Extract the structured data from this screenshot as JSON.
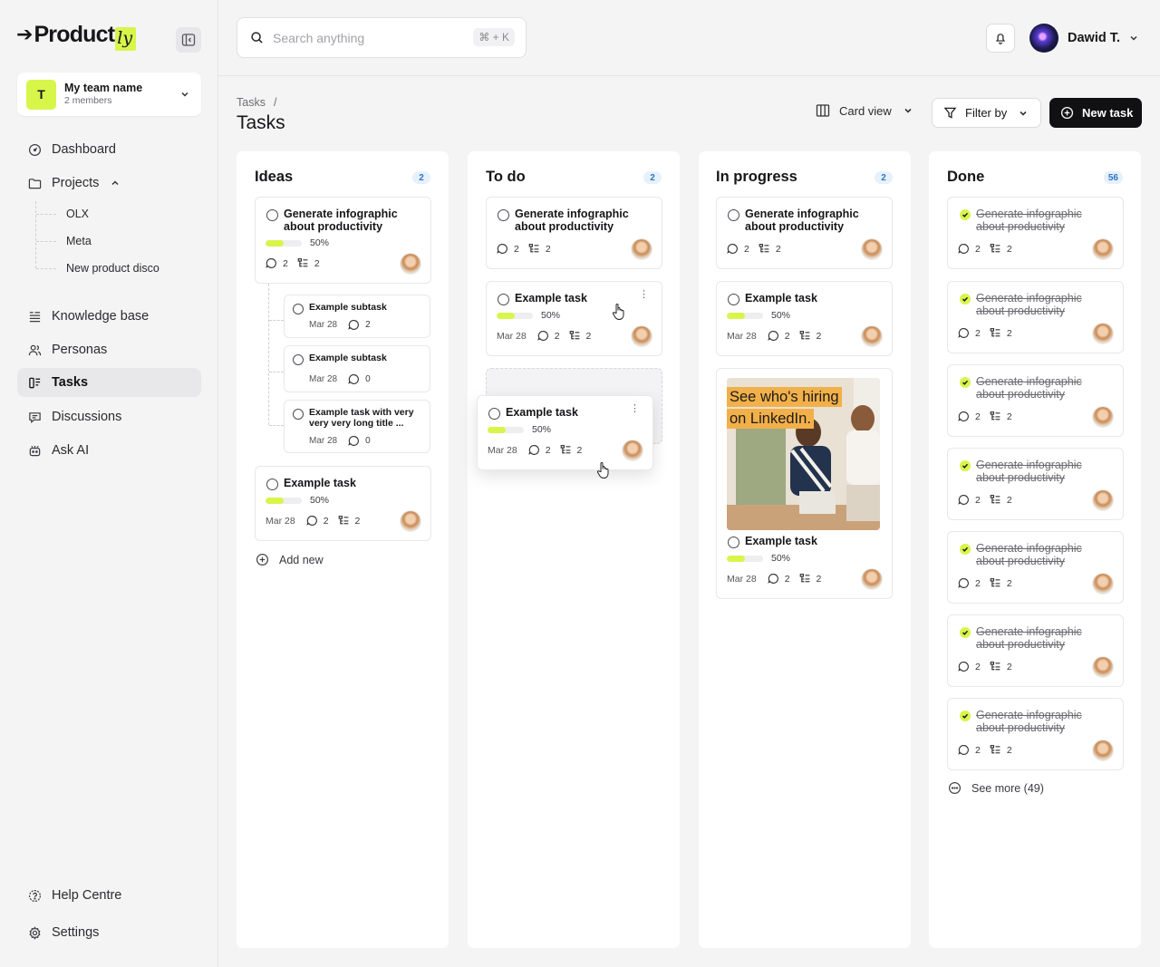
{
  "brand": {
    "name": "Product",
    "suffix": "ly"
  },
  "team": {
    "initial": "T",
    "name": "My team name",
    "members": "2 members"
  },
  "nav": {
    "dashboard": "Dashboard",
    "projects": "Projects",
    "projects_children": [
      "OLX",
      "Meta",
      "New product disco"
    ],
    "knowledge_base": "Knowledge base",
    "personas": "Personas",
    "tasks": "Tasks",
    "discussions": "Discussions",
    "ask_ai": "Ask AI",
    "help_centre": "Help Centre",
    "settings": "Settings"
  },
  "search": {
    "placeholder": "Search anything",
    "shortcut": "⌘ + K"
  },
  "user": {
    "name": "Dawid T."
  },
  "page": {
    "breadcrumb_root": "Tasks",
    "breadcrumb_sep": "/",
    "title": "Tasks",
    "view_label": "Card view",
    "filter_label": "Filter by",
    "new_task_label": "New task"
  },
  "columns": [
    {
      "title": "Ideas",
      "count": "2"
    },
    {
      "title": "To do",
      "count": "2"
    },
    {
      "title": "In progress",
      "count": "2"
    },
    {
      "title": "Done",
      "count": "56"
    }
  ],
  "ideas": {
    "card1": {
      "title": "Generate infographic about productivity",
      "progress": "50%",
      "progress_value": 0.5,
      "comments": "2",
      "subtasks": "2"
    },
    "subtasks": [
      {
        "title": "Example subtask",
        "date": "Mar 28",
        "comments": "2"
      },
      {
        "title": "Example subtask",
        "date": "Mar 28",
        "comments": "0"
      },
      {
        "title": "Example task with very very very long title ...",
        "date": "Mar 28",
        "comments": "0"
      }
    ],
    "card2": {
      "title": "Example task",
      "progress": "50%",
      "progress_value": 0.5,
      "date": "Mar 28",
      "comments": "2",
      "subtasks": "2"
    },
    "add_new": "Add new"
  },
  "todo": {
    "card1": {
      "title": "Generate infographic about productivity",
      "comments": "2",
      "subtasks": "2"
    },
    "card2": {
      "title": "Example task",
      "progress": "50%",
      "progress_value": 0.5,
      "date": "Mar 28",
      "comments": "2",
      "subtasks": "2"
    },
    "dragging": {
      "title": "Example task",
      "progress": "50%",
      "progress_value": 0.5,
      "date": "Mar 28",
      "comments": "2",
      "subtasks": "2"
    }
  },
  "inprogress": {
    "card1": {
      "title": "Generate infographic about productivity",
      "comments": "2",
      "subtasks": "2"
    },
    "card2": {
      "title": "Example task",
      "progress": "50%",
      "progress_value": 0.5,
      "date": "Mar 28",
      "comments": "2",
      "subtasks": "2"
    },
    "card3": {
      "image_text_line1": "See who's hiring",
      "image_text_line2": "on LinkedIn.",
      "title": "Example task",
      "progress": "50%",
      "progress_value": 0.5,
      "date": "Mar 28",
      "comments": "2",
      "subtasks": "2"
    }
  },
  "done": {
    "card_title": "Generate infographic about productivity",
    "comments": "2",
    "subtasks": "2",
    "see_more": "See more (49)"
  },
  "colors": {
    "accent": "#d8f54a",
    "count_badge": "#e6f1fb",
    "count_text": "#2f74c9",
    "primary_button": "#111114"
  }
}
